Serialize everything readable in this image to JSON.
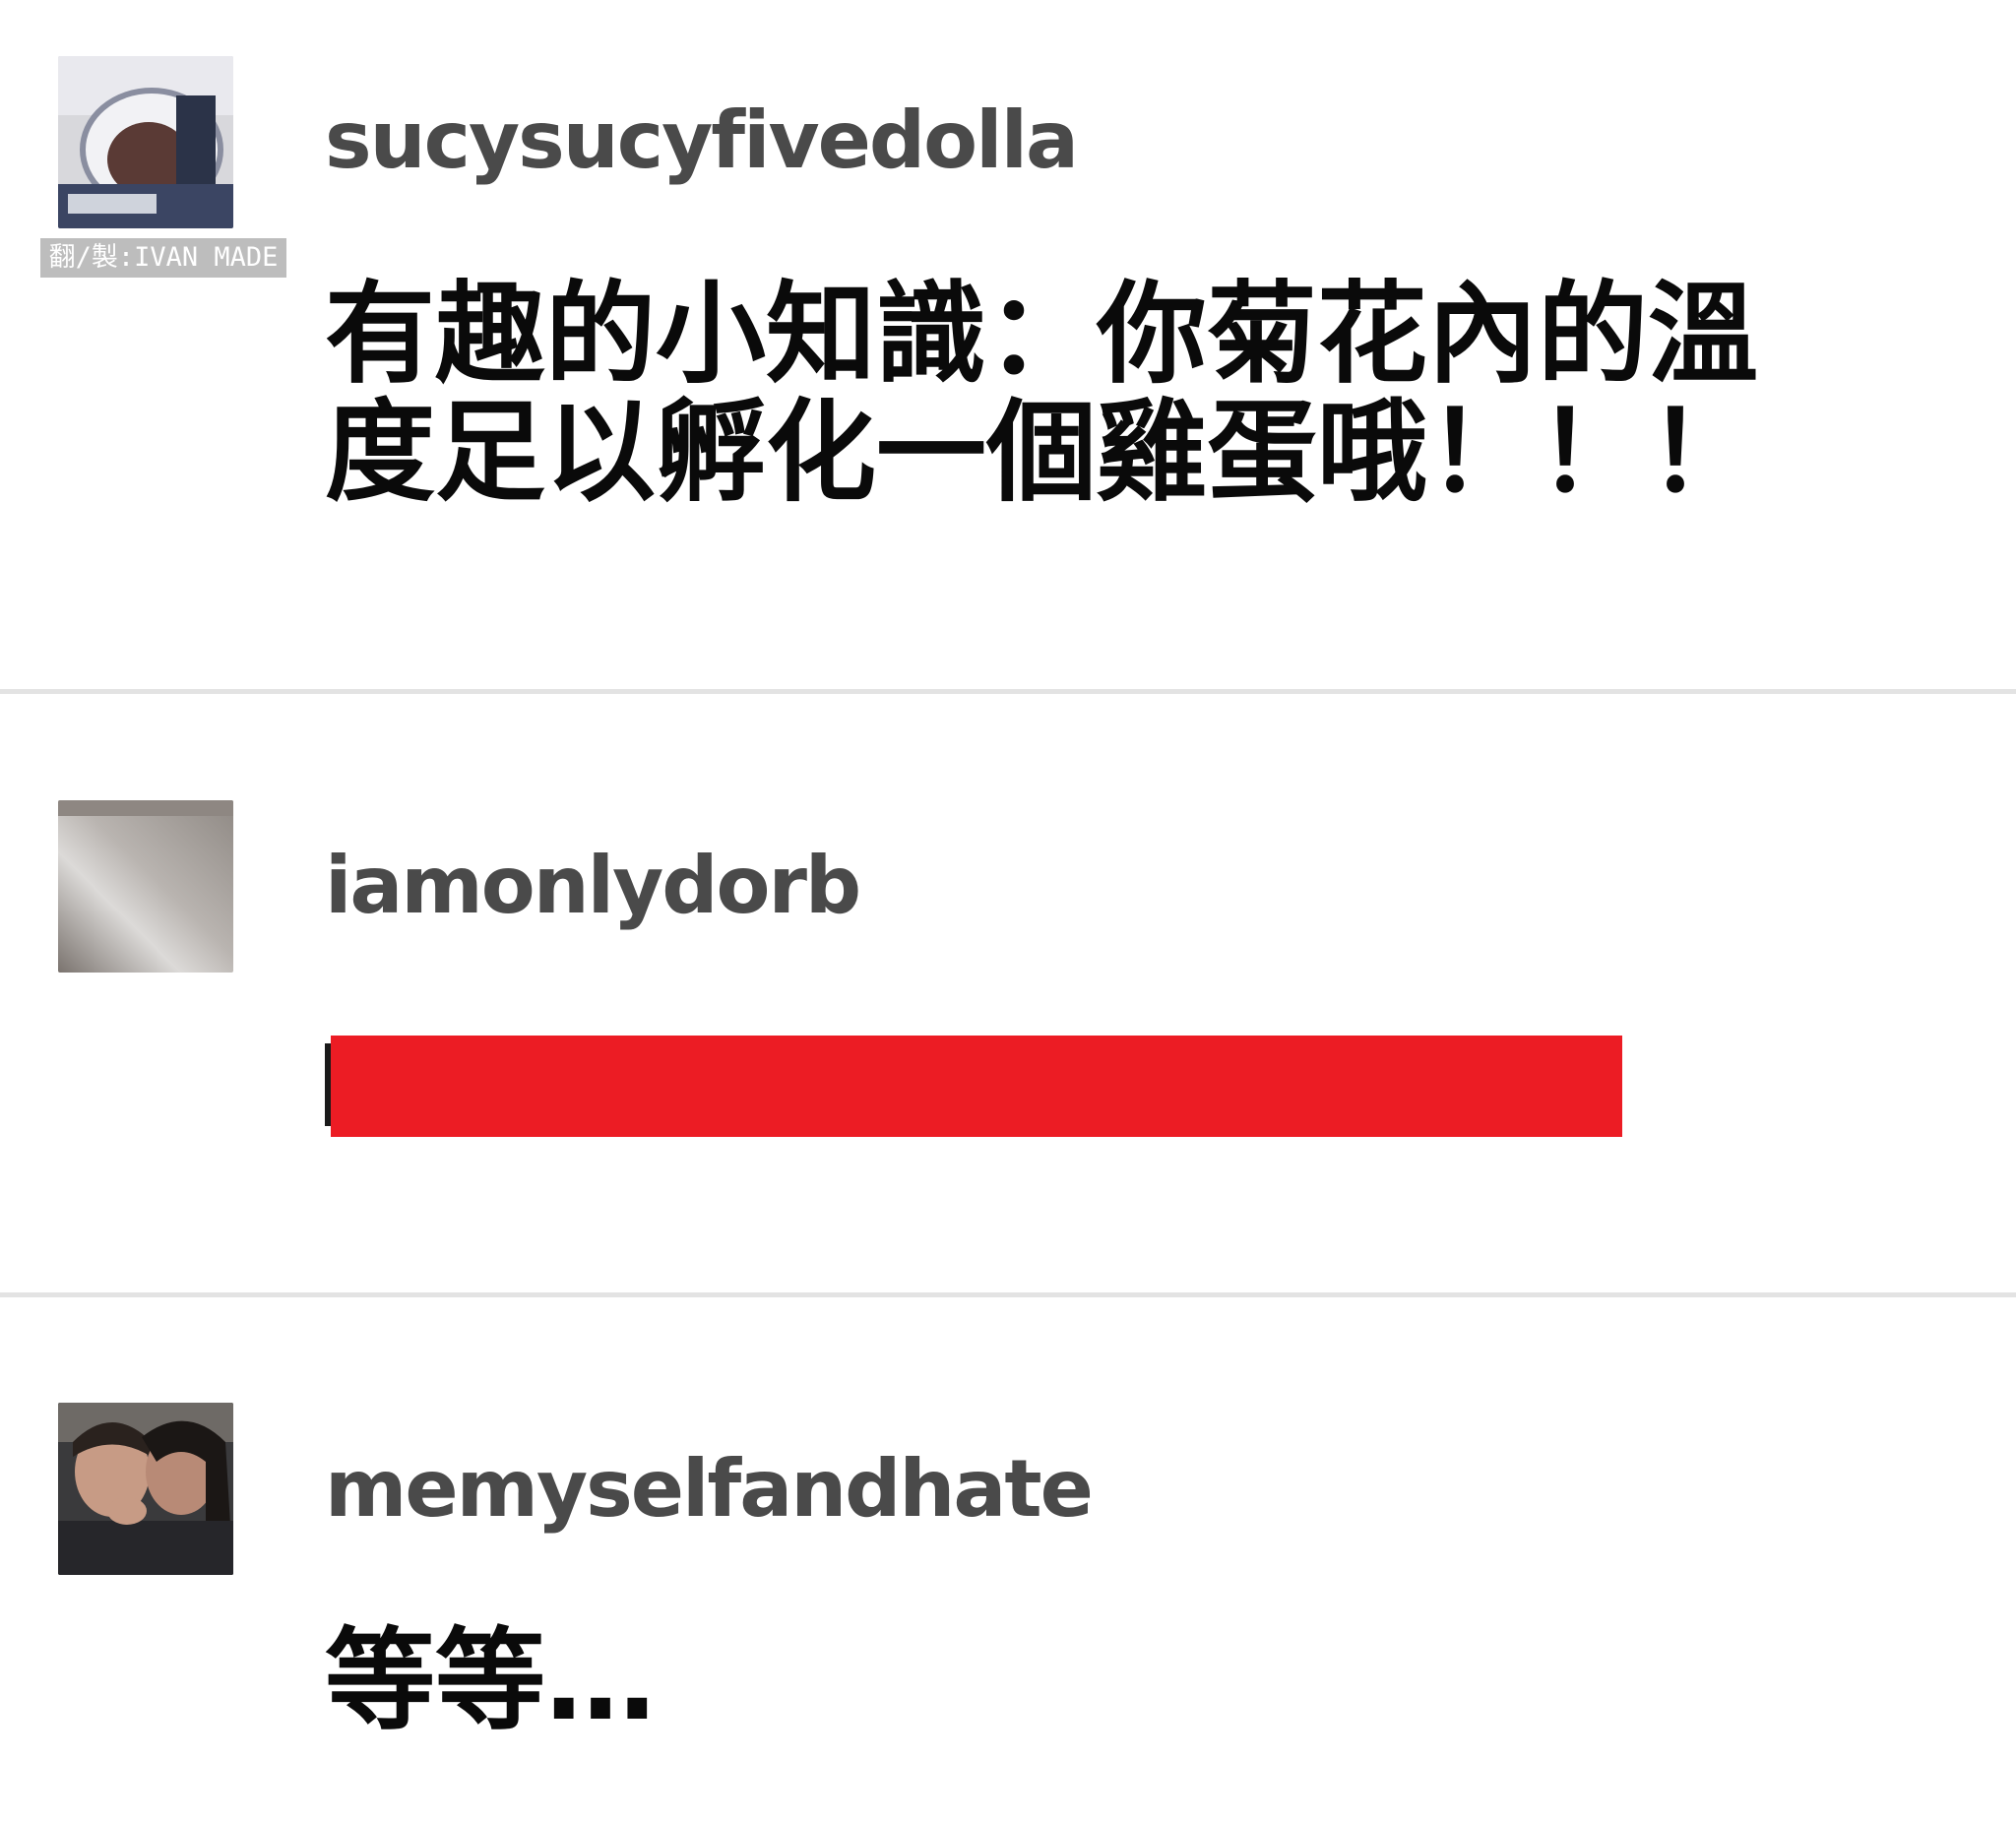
{
  "watermark": "翻/製:IVAN MADE",
  "posts": [
    {
      "username": "sucysucyfivedolla",
      "text": "有趣的小知識：你菊花內的溫度足以孵化一個雞蛋哦！！！"
    },
    {
      "username": "iamonlydorb",
      "text": "",
      "redaction_color": "#ec1c24"
    },
    {
      "username": "memyselfandhate",
      "text": "等等…"
    }
  ],
  "colors": {
    "username": "#4a4a4a",
    "text": "#0a0a0a",
    "divider": "#e3e3e3",
    "redaction": "#ec1c24",
    "watermark_bg": "#bdbdbd"
  }
}
